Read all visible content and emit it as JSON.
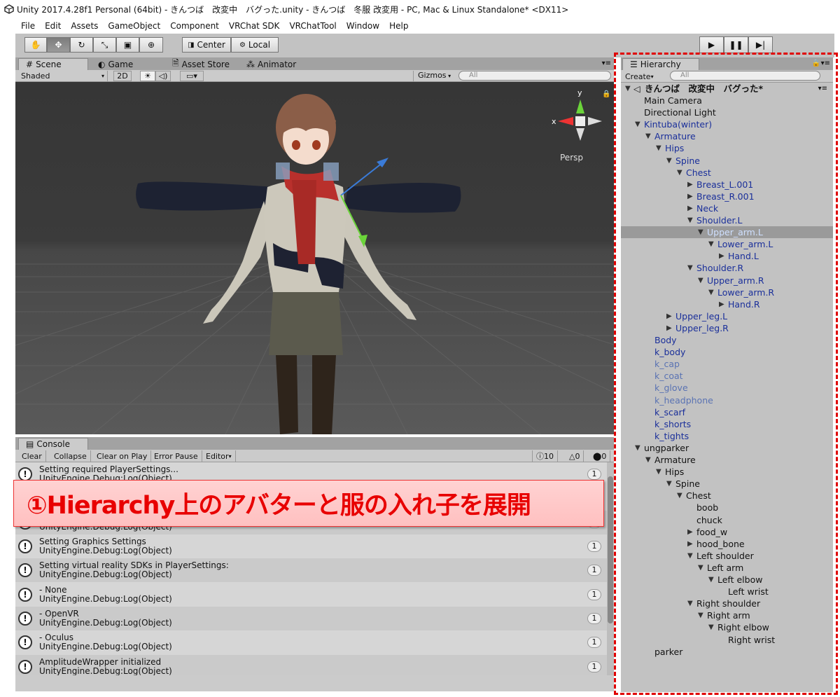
{
  "window": {
    "title": "Unity 2017.4.28f1 Personal (64bit) - きんつば　改変中　バグった.unity - きんつば　冬服 改変用 - PC, Mac & Linux Standalone* <DX11>"
  },
  "menu": [
    "File",
    "Edit",
    "Assets",
    "GameObject",
    "Component",
    "VRChat SDK",
    "VRChatTool",
    "Window",
    "Help"
  ],
  "toolbar": {
    "center_label": "Center",
    "local_label": "Local"
  },
  "scene_tabs": {
    "scene": "Scene",
    "game": "Game",
    "asset_store": "Asset Store",
    "animator": "Animator"
  },
  "scene_opts": {
    "shading": "Shaded",
    "mode_2d": "2D",
    "gizmos": "Gizmos",
    "search_placeholder": "All"
  },
  "gizmo": {
    "y": "y",
    "x": "x",
    "persp": "Persp"
  },
  "console": {
    "tab": "Console",
    "buttons": {
      "clear": "Clear",
      "collapse": "Collapse",
      "clear_on_play": "Clear on Play",
      "error_pause": "Error Pause",
      "editor": "Editor"
    },
    "counts": {
      "logs": "10",
      "warnings": "0",
      "errors": "0"
    },
    "rows": [
      {
        "line1": "Setting required PlayerSettings...",
        "line2": "UnityEngine.Debug:Log(Object)",
        "count": "1"
      },
      {
        "line1": "",
        "line2": "UnityEngine.Debug:Log(Object)",
        "count": "1"
      },
      {
        "line1": "Setting Graphics Settings",
        "line2": "UnityEngine.Debug:Log(Object)",
        "count": "1"
      },
      {
        "line1": "Setting virtual reality SDKs in PlayerSettings:",
        "line2": "UnityEngine.Debug:Log(Object)",
        "count": "1"
      },
      {
        "line1": "- None",
        "line2": "UnityEngine.Debug:Log(Object)",
        "count": "1"
      },
      {
        "line1": "- OpenVR",
        "line2": "UnityEngine.Debug:Log(Object)",
        "count": "1"
      },
      {
        "line1": "- Oculus",
        "line2": "UnityEngine.Debug:Log(Object)",
        "count": "1"
      },
      {
        "line1": "AmplitudeWrapper initialized",
        "line2": "UnityEngine.Debug:Log(Object)",
        "count": "1"
      }
    ]
  },
  "callout": {
    "text": "①Hierarchy上のアバターと服の入れ子を展開"
  },
  "hierarchy": {
    "tab": "Hierarchy",
    "create": "Create",
    "search_placeholder": "All",
    "scene": "きんつば　改変中　バグった*",
    "items": [
      {
        "label": "Main Camera",
        "depth": 1,
        "arrow": "",
        "color": "black"
      },
      {
        "label": "Directional Light",
        "depth": 1,
        "arrow": "",
        "color": "black"
      },
      {
        "label": "Kintuba(winter)",
        "depth": 1,
        "arrow": "down",
        "color": "blue"
      },
      {
        "label": "Armature",
        "depth": 2,
        "arrow": "down",
        "color": "blue"
      },
      {
        "label": "Hips",
        "depth": 3,
        "arrow": "down",
        "color": "blue"
      },
      {
        "label": "Spine",
        "depth": 4,
        "arrow": "down",
        "color": "blue"
      },
      {
        "label": "Chest",
        "depth": 5,
        "arrow": "down",
        "color": "blue"
      },
      {
        "label": "Breast_L.001",
        "depth": 6,
        "arrow": "right",
        "color": "blue"
      },
      {
        "label": "Breast_R.001",
        "depth": 6,
        "arrow": "right",
        "color": "blue"
      },
      {
        "label": "Neck",
        "depth": 6,
        "arrow": "right",
        "color": "blue"
      },
      {
        "label": "Shoulder.L",
        "depth": 6,
        "arrow": "down",
        "color": "blue"
      },
      {
        "label": "Upper_arm.L",
        "depth": 7,
        "arrow": "down",
        "color": "blue",
        "selected": true
      },
      {
        "label": "Lower_arm.L",
        "depth": 8,
        "arrow": "down",
        "color": "blue"
      },
      {
        "label": "Hand.L",
        "depth": 9,
        "arrow": "right",
        "color": "blue"
      },
      {
        "label": "Shoulder.R",
        "depth": 6,
        "arrow": "down",
        "color": "blue"
      },
      {
        "label": "Upper_arm.R",
        "depth": 7,
        "arrow": "down",
        "color": "blue"
      },
      {
        "label": "Lower_arm.R",
        "depth": 8,
        "arrow": "down",
        "color": "blue"
      },
      {
        "label": "Hand.R",
        "depth": 9,
        "arrow": "right",
        "color": "blue"
      },
      {
        "label": "Upper_leg.L",
        "depth": 4,
        "arrow": "right",
        "color": "blue"
      },
      {
        "label": "Upper_leg.R",
        "depth": 4,
        "arrow": "right",
        "color": "blue"
      },
      {
        "label": "Body",
        "depth": 2,
        "arrow": "",
        "color": "blue"
      },
      {
        "label": "k_body",
        "depth": 2,
        "arrow": "",
        "color": "blue"
      },
      {
        "label": "k_cap",
        "depth": 2,
        "arrow": "",
        "color": "faded"
      },
      {
        "label": "k_coat",
        "depth": 2,
        "arrow": "",
        "color": "faded"
      },
      {
        "label": "k_glove",
        "depth": 2,
        "arrow": "",
        "color": "faded"
      },
      {
        "label": "k_headphone",
        "depth": 2,
        "arrow": "",
        "color": "faded"
      },
      {
        "label": "k_scarf",
        "depth": 2,
        "arrow": "",
        "color": "blue"
      },
      {
        "label": "k_shorts",
        "depth": 2,
        "arrow": "",
        "color": "blue"
      },
      {
        "label": "k_tights",
        "depth": 2,
        "arrow": "",
        "color": "blue"
      },
      {
        "label": "ungparker",
        "depth": 1,
        "arrow": "down",
        "color": "black"
      },
      {
        "label": "Armature",
        "depth": 2,
        "arrow": "down",
        "color": "black"
      },
      {
        "label": "Hips",
        "depth": 3,
        "arrow": "down",
        "color": "black"
      },
      {
        "label": "Spine",
        "depth": 4,
        "arrow": "down",
        "color": "black"
      },
      {
        "label": "Chest",
        "depth": 5,
        "arrow": "down",
        "color": "black"
      },
      {
        "label": "boob",
        "depth": 6,
        "arrow": "",
        "color": "black"
      },
      {
        "label": "chuck",
        "depth": 6,
        "arrow": "",
        "color": "black"
      },
      {
        "label": "food_w",
        "depth": 6,
        "arrow": "right",
        "color": "black"
      },
      {
        "label": "hood_bone",
        "depth": 6,
        "arrow": "right",
        "color": "black"
      },
      {
        "label": "Left shoulder",
        "depth": 6,
        "arrow": "down",
        "color": "black"
      },
      {
        "label": "Left arm",
        "depth": 7,
        "arrow": "down",
        "color": "black"
      },
      {
        "label": "Left elbow",
        "depth": 8,
        "arrow": "down",
        "color": "black"
      },
      {
        "label": "Left wrist",
        "depth": 9,
        "arrow": "",
        "color": "black"
      },
      {
        "label": "Right shoulder",
        "depth": 6,
        "arrow": "down",
        "color": "black"
      },
      {
        "label": "Right arm",
        "depth": 7,
        "arrow": "down",
        "color": "black"
      },
      {
        "label": "Right elbow",
        "depth": 8,
        "arrow": "down",
        "color": "black"
      },
      {
        "label": "Right wrist",
        "depth": 9,
        "arrow": "",
        "color": "black"
      },
      {
        "label": "parker",
        "depth": 2,
        "arrow": "",
        "color": "black"
      }
    ]
  },
  "colors": {
    "highlight": "#e00000",
    "callout_text": "#e80000",
    "hier_blue": "#1a2f9a",
    "hier_faded": "#5a73b3"
  }
}
